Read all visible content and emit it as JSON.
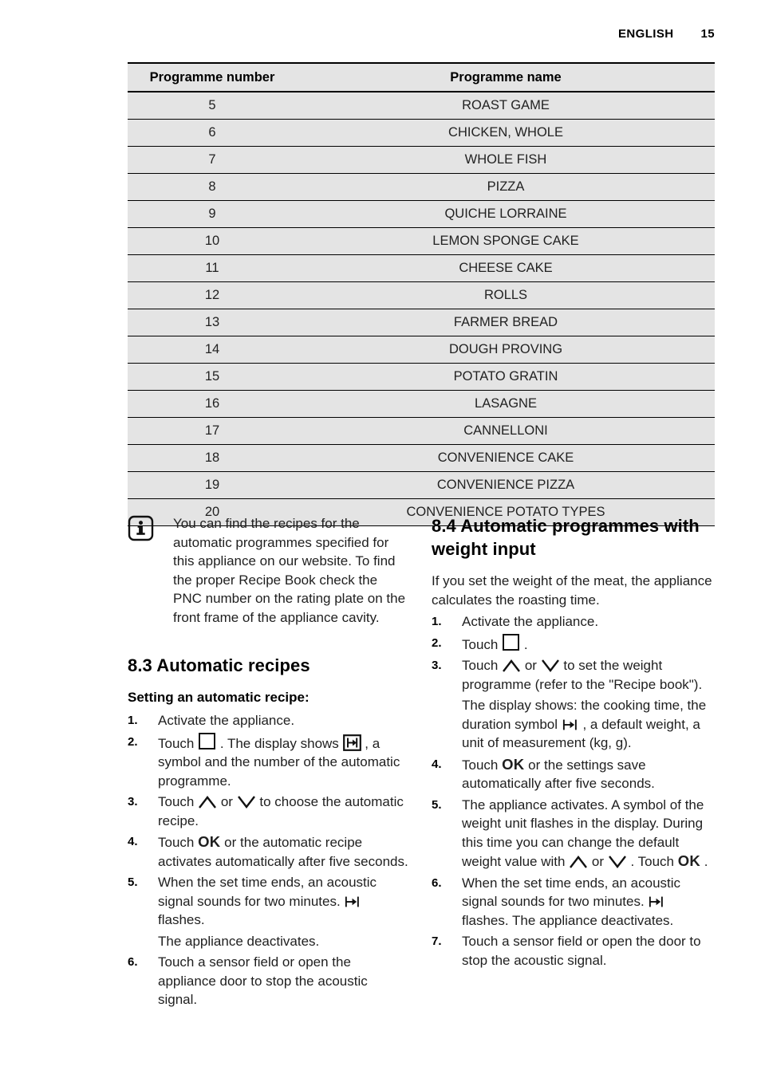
{
  "header": {
    "language": "ENGLISH",
    "page_number": "15"
  },
  "table": {
    "columns": [
      "Programme number",
      "Programme name"
    ],
    "rows": [
      {
        "number": "5",
        "name": "ROAST GAME"
      },
      {
        "number": "6",
        "name": "CHICKEN, WHOLE"
      },
      {
        "number": "7",
        "name": "WHOLE FISH"
      },
      {
        "number": "8",
        "name": "PIZZA"
      },
      {
        "number": "9",
        "name": "QUICHE LORRAINE"
      },
      {
        "number": "10",
        "name": "LEMON SPONGE CAKE"
      },
      {
        "number": "11",
        "name": "CHEESE CAKE"
      },
      {
        "number": "12",
        "name": "ROLLS"
      },
      {
        "number": "13",
        "name": "FARMER BREAD"
      },
      {
        "number": "14",
        "name": "DOUGH PROVING"
      },
      {
        "number": "15",
        "name": "POTATO GRATIN"
      },
      {
        "number": "16",
        "name": "LASAGNE"
      },
      {
        "number": "17",
        "name": "CANNELLONI"
      },
      {
        "number": "18",
        "name": "CONVENIENCE CAKE"
      },
      {
        "number": "19",
        "name": "CONVENIENCE PIZZA"
      },
      {
        "number": "20",
        "name": "CONVENIENCE POTATO TYPES"
      }
    ]
  },
  "note": {
    "icon": "info-icon",
    "text": "You can find the recipes for the automatic programmes specified for this appliance on our website. To find the proper Recipe Book check the PNC number on the rating plate on the front frame of the appliance cavity."
  },
  "section_8_3": {
    "number": "8.3",
    "title": "Automatic recipes",
    "subheading": "Setting an automatic recipe:",
    "steps": [
      {
        "marker": "1.",
        "parts": [
          {
            "type": "text",
            "value": "Activate the appliance."
          }
        ]
      },
      {
        "marker": "2.",
        "parts": [
          {
            "type": "text",
            "value": "Touch "
          },
          {
            "type": "glyph",
            "value": "square-icon"
          },
          {
            "type": "text",
            "value": " . The display shows "
          },
          {
            "type": "glyph",
            "value": "boxed-duration-icon"
          },
          {
            "type": "text",
            "value": " , a symbol and the number of the automatic programme."
          }
        ]
      },
      {
        "marker": "3.",
        "parts": [
          {
            "type": "text",
            "value": "Touch "
          },
          {
            "type": "glyph",
            "value": "chevron-up-icon"
          },
          {
            "type": "text",
            "value": " or "
          },
          {
            "type": "glyph",
            "value": "chevron-down-icon"
          },
          {
            "type": "text",
            "value": " to choose the automatic recipe."
          }
        ]
      },
      {
        "marker": "4.",
        "parts": [
          {
            "type": "text",
            "value": "Touch "
          },
          {
            "type": "ok",
            "value": "OK"
          },
          {
            "type": "text",
            "value": " or the automatic recipe activates automatically after five seconds."
          }
        ]
      },
      {
        "marker": "5.",
        "parts": [
          {
            "type": "text",
            "value": "When the set time ends, an acoustic signal sounds for two minutes. "
          },
          {
            "type": "glyph",
            "value": "duration-icon"
          },
          {
            "type": "text",
            "value": " flashes."
          }
        ],
        "sub_paragraph": "The appliance deactivates."
      },
      {
        "marker": "6.",
        "parts": [
          {
            "type": "text",
            "value": "Touch a sensor field or open the appliance door to stop the acoustic signal."
          }
        ]
      }
    ]
  },
  "section_8_4": {
    "number": "8.4",
    "title": "Automatic programmes with weight input",
    "intro": "If you set the weight of the meat, the appliance calculates the roasting time.",
    "steps": [
      {
        "marker": "1.",
        "parts": [
          {
            "type": "text",
            "value": "Activate the appliance."
          }
        ]
      },
      {
        "marker": "2.",
        "parts": [
          {
            "type": "text",
            "value": "Touch "
          },
          {
            "type": "glyph",
            "value": "square-icon"
          },
          {
            "type": "text",
            "value": " ."
          }
        ]
      },
      {
        "marker": "3.",
        "parts": [
          {
            "type": "text",
            "value": "Touch "
          },
          {
            "type": "glyph",
            "value": "chevron-up-icon"
          },
          {
            "type": "text",
            "value": " or "
          },
          {
            "type": "glyph",
            "value": "chevron-down-icon"
          },
          {
            "type": "text",
            "value": " to set the weight programme (refer to the \"Recipe book\")."
          }
        ],
        "sub_parts": [
          {
            "type": "text",
            "value": "The display shows: the cooking time, the duration symbol "
          },
          {
            "type": "glyph",
            "value": "duration-icon"
          },
          {
            "type": "text",
            "value": " , a default weight, a unit of measurement (kg, g)."
          }
        ]
      },
      {
        "marker": "4.",
        "parts": [
          {
            "type": "text",
            "value": "Touch "
          },
          {
            "type": "ok",
            "value": "OK"
          },
          {
            "type": "text",
            "value": " or the settings save automatically after five seconds."
          }
        ]
      },
      {
        "marker": "5.",
        "parts": [
          {
            "type": "text",
            "value": "The appliance activates. A symbol of the weight unit flashes in the display. During this time you can change the default weight value with "
          },
          {
            "type": "glyph",
            "value": "chevron-up-icon"
          },
          {
            "type": "text",
            "value": " or "
          },
          {
            "type": "glyph",
            "value": "chevron-down-icon"
          },
          {
            "type": "text",
            "value": " . Touch "
          },
          {
            "type": "ok",
            "value": "OK"
          },
          {
            "type": "text",
            "value": " ."
          }
        ]
      },
      {
        "marker": "6.",
        "parts": [
          {
            "type": "text",
            "value": "When the set time ends, an acoustic signal sounds for two minutes. "
          },
          {
            "type": "glyph",
            "value": "duration-icon"
          },
          {
            "type": "text",
            "value": " flashes. The appliance deactivates."
          }
        ]
      },
      {
        "marker": "7.",
        "parts": [
          {
            "type": "text",
            "value": "Touch a sensor field or open the door to stop the acoustic signal."
          }
        ]
      }
    ]
  },
  "colors": {
    "table_row_background": "#e4e4e4",
    "rule": "#000000",
    "text": "#1f1f1f"
  }
}
